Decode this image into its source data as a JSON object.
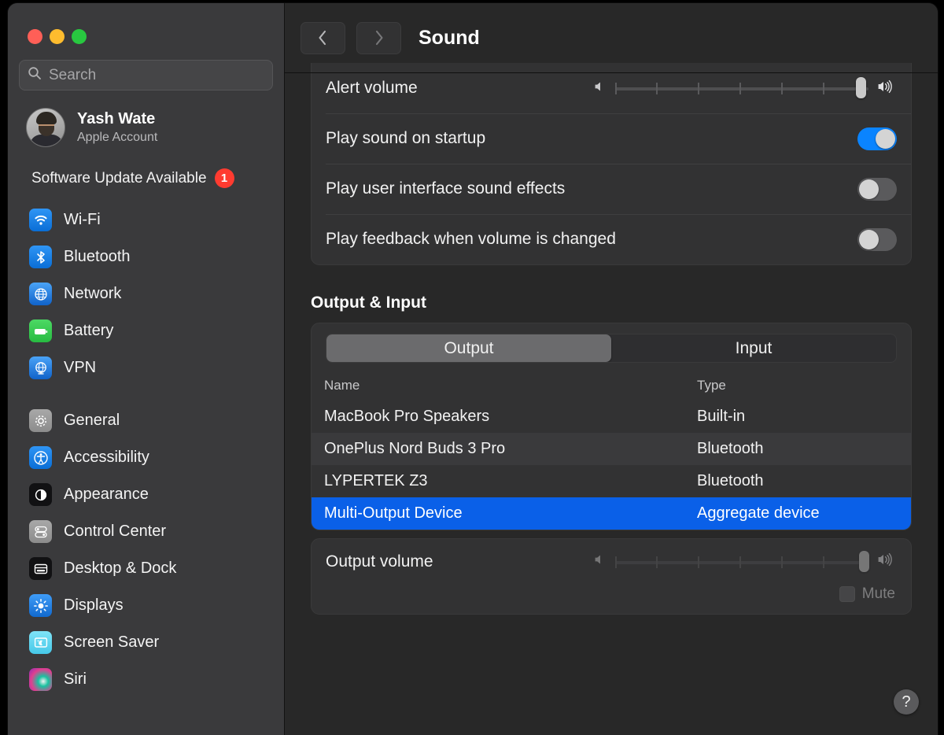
{
  "window": {
    "traffic_lights": [
      "close",
      "minimize",
      "zoom"
    ],
    "colors": {
      "close": "#ff5f57",
      "minimize": "#febc2e",
      "zoom": "#28c840",
      "accent": "#0a84ff",
      "selection": "#0a60e8",
      "badge": "#ff3b30"
    }
  },
  "sidebar": {
    "search": {
      "placeholder": "Search",
      "value": ""
    },
    "account": {
      "name": "Yash Wate",
      "subtitle": "Apple Account"
    },
    "software_update": {
      "label": "Software Update Available",
      "badge": "1"
    },
    "groups": [
      {
        "items": [
          {
            "label": "Wi-Fi",
            "icon": "wifi-icon"
          },
          {
            "label": "Bluetooth",
            "icon": "bluetooth-icon"
          },
          {
            "label": "Network",
            "icon": "globe-icon"
          },
          {
            "label": "Battery",
            "icon": "battery-icon"
          },
          {
            "label": "VPN",
            "icon": "vpn-globe-icon"
          }
        ]
      },
      {
        "items": [
          {
            "label": "General",
            "icon": "gear-icon"
          },
          {
            "label": "Accessibility",
            "icon": "accessibility-icon"
          },
          {
            "label": "Appearance",
            "icon": "appearance-icon"
          },
          {
            "label": "Control Center",
            "icon": "control-center-icon"
          },
          {
            "label": "Desktop & Dock",
            "icon": "desktop-dock-icon"
          },
          {
            "label": "Displays",
            "icon": "brightness-icon"
          },
          {
            "label": "Screen Saver",
            "icon": "screen-saver-icon"
          },
          {
            "label": "Siri",
            "icon": "siri-icon"
          }
        ]
      }
    ]
  },
  "toolbar": {
    "back_label": "‹",
    "forward_label": "›",
    "title": "Sound"
  },
  "sound": {
    "alert_volume": {
      "label": "Alert volume",
      "value_percent": 95,
      "ticks": 7
    },
    "toggles": [
      {
        "label": "Play sound on startup",
        "on": true
      },
      {
        "label": "Play user interface sound effects",
        "on": false
      },
      {
        "label": "Play feedback when volume is changed",
        "on": false
      }
    ],
    "output_input": {
      "section_title": "Output & Input",
      "tabs": [
        {
          "label": "Output",
          "active": true
        },
        {
          "label": "Input",
          "active": false
        }
      ],
      "columns": [
        "Name",
        "Type"
      ],
      "rows": [
        {
          "name": "MacBook Pro Speakers",
          "type": "Built-in",
          "selected": false
        },
        {
          "name": "OnePlus Nord Buds 3 Pro",
          "type": "Bluetooth",
          "selected": false
        },
        {
          "name": "LYPERTEK Z3",
          "type": "Bluetooth",
          "selected": false
        },
        {
          "name": "Multi-Output Device",
          "type": "Aggregate device",
          "selected": true
        }
      ]
    },
    "output_volume": {
      "label": "Output volume",
      "value_percent": 97,
      "ticks": 7,
      "disabled": true,
      "mute": {
        "label": "Mute",
        "checked": false,
        "disabled": true
      }
    }
  },
  "help": {
    "label": "?"
  }
}
